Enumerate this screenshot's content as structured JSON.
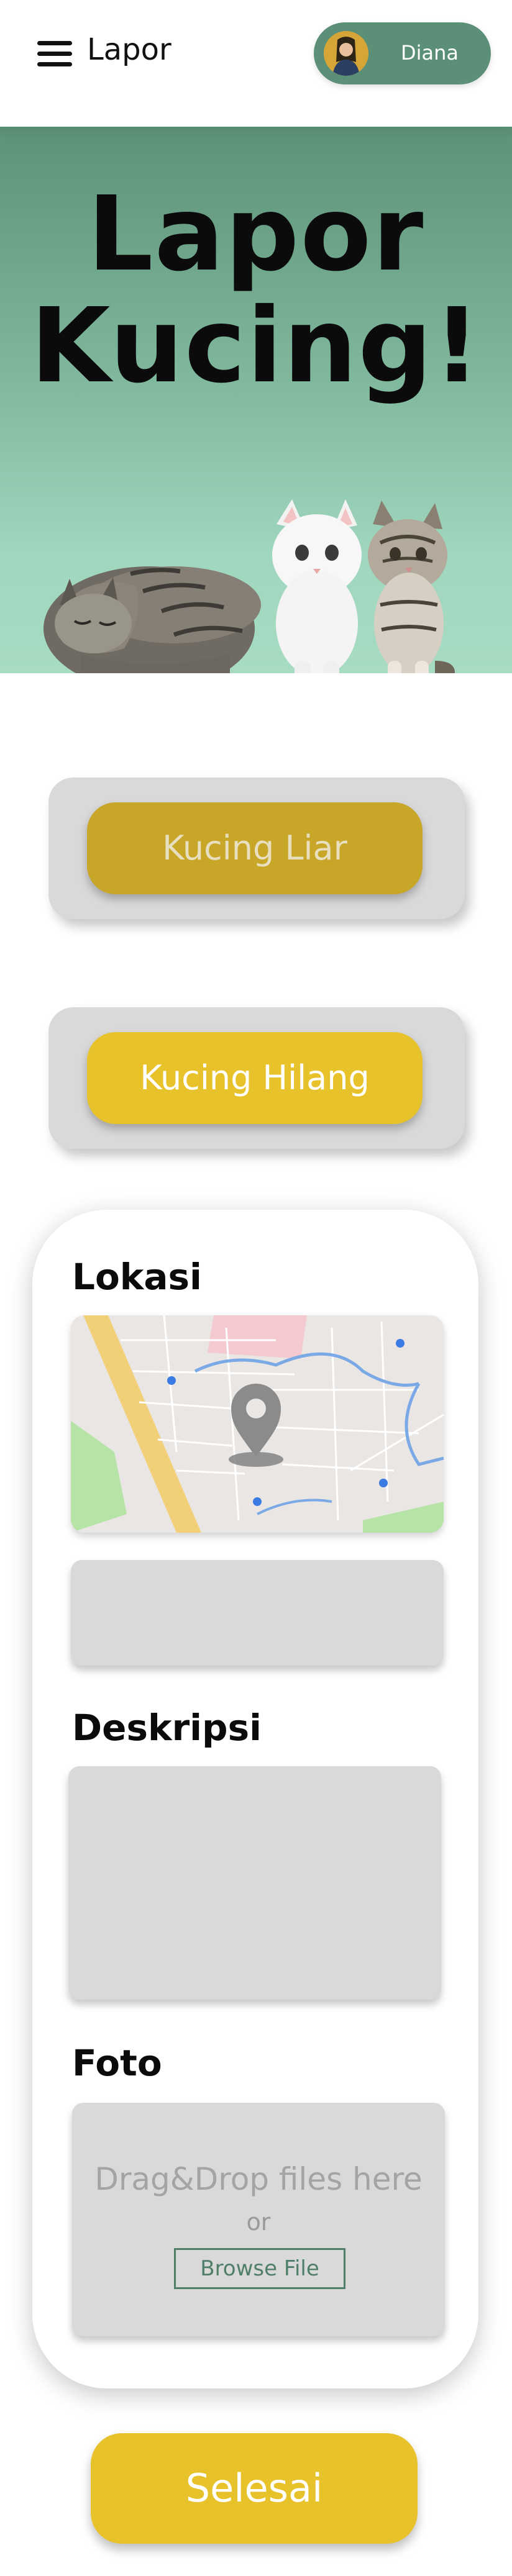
{
  "header": {
    "menu_icon": "hamburger-menu-icon",
    "title": "Lapor",
    "user": {
      "name": "Diana",
      "avatar_icon": "user-avatar"
    }
  },
  "hero": {
    "title_line1": "Lapor",
    "title_line2": "Kucing!",
    "image": "cats-illustration"
  },
  "report_types": {
    "liar_label": "Kucing Liar",
    "hilang_label": "Kucing Hilang"
  },
  "form": {
    "location_label": "Lokasi",
    "map_icon": "map-pin-icon",
    "location_input_value": "",
    "description_label": "Deskripsi",
    "description_value": "",
    "photo_label": "Foto",
    "dropzone_text": "Drag&Drop files here",
    "dropzone_or": "or",
    "browse_label": "Browse File"
  },
  "footer": {
    "finish_label": "Selesai"
  },
  "colors": {
    "accent_green": "#5b8f78",
    "hero_gradient_top": "#5c9278",
    "hero_gradient_bottom": "#a7dcc3",
    "yellow_primary": "#e8c22b",
    "yellow_dark": "#c8a627",
    "card_gray": "#d9d9d9"
  }
}
